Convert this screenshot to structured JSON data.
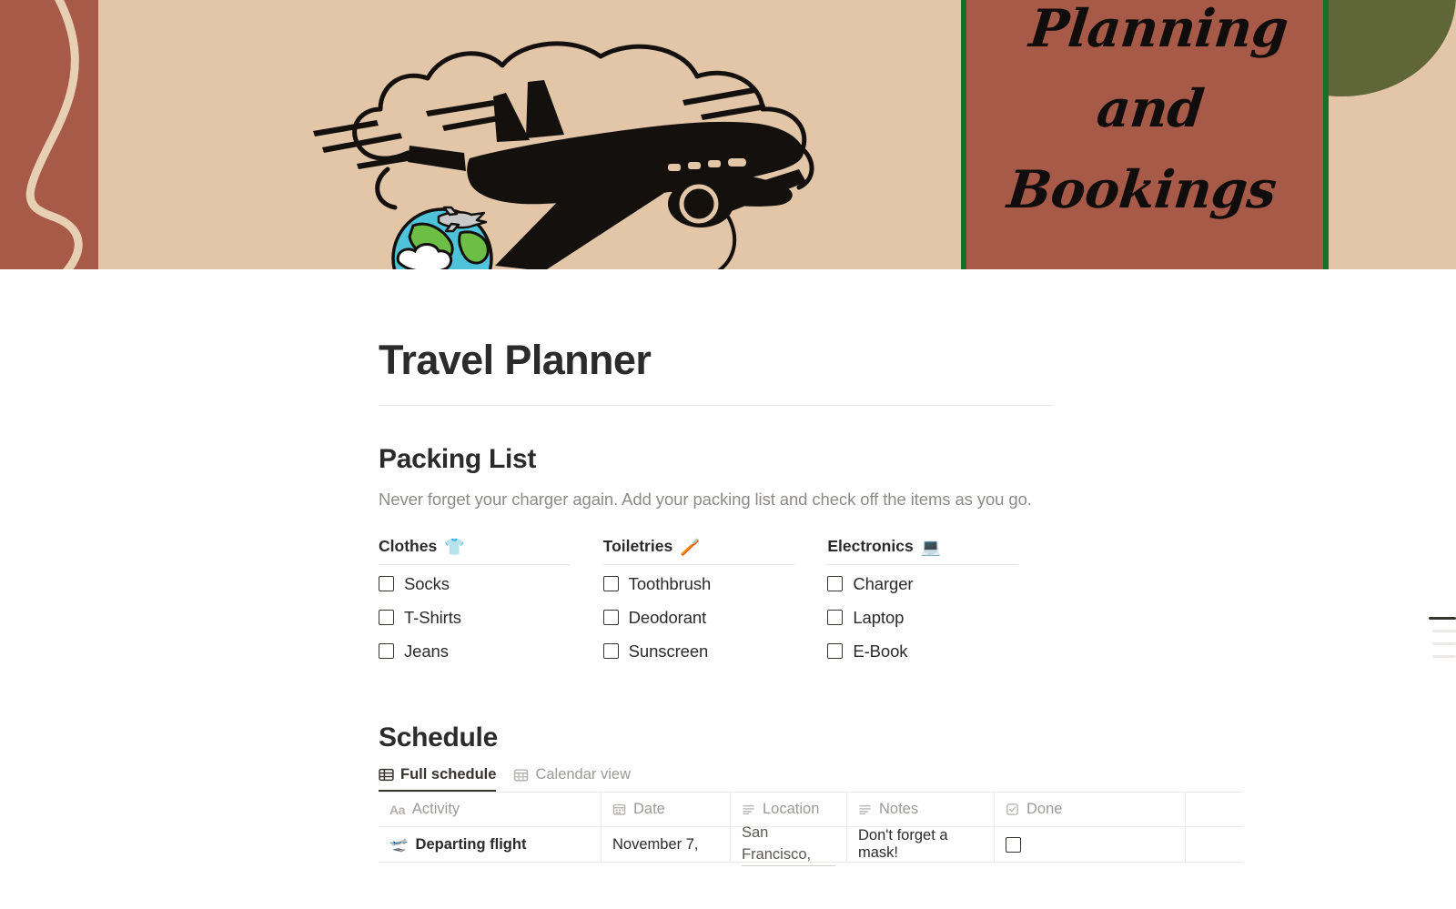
{
  "cover": {
    "script_line1": "Planning and",
    "script_line2": "Bookings",
    "colors": {
      "rust": "#a85a48",
      "beige": "#e3c6a8",
      "olive": "#5f6638",
      "green_border": "#177028",
      "ink": "#100d0c"
    },
    "artwork_name": "vintage-airplane-illustration",
    "globe_emoji": "🌍"
  },
  "page": {
    "title": "Travel Planner"
  },
  "packing": {
    "heading": "Packing List",
    "description": "Never forget your charger again. Add your packing list and check off the items as you go.",
    "columns": [
      {
        "title": "Clothes",
        "emoji": "👕",
        "emoji_name": "t-shirt-emoji",
        "items": [
          "Socks",
          "T-Shirts",
          "Jeans"
        ]
      },
      {
        "title": "Toiletries",
        "emoji": "🪥",
        "emoji_name": "toothbrush-emoji",
        "items": [
          "Toothbrush",
          "Deodorant",
          "Sunscreen"
        ]
      },
      {
        "title": "Electronics",
        "emoji": "💻",
        "emoji_name": "laptop-emoji",
        "items": [
          "Charger",
          "Laptop",
          "E-Book"
        ]
      }
    ]
  },
  "schedule": {
    "heading": "Schedule",
    "views": [
      {
        "label": "Full schedule",
        "icon": "table-icon",
        "active": true
      },
      {
        "label": "Calendar view",
        "icon": "calendar-icon",
        "active": false
      }
    ],
    "table": {
      "columns": [
        {
          "label": "Activity",
          "icon": "text-type-icon"
        },
        {
          "label": "Date",
          "icon": "calendar-type-icon"
        },
        {
          "label": "Location",
          "icon": "text-lines-icon"
        },
        {
          "label": "Notes",
          "icon": "text-lines-icon"
        },
        {
          "label": "Done",
          "icon": "checkbox-type-icon"
        }
      ],
      "rows": [
        {
          "activity": "Departing flight",
          "activity_emoji": "🛫",
          "date": "November 7,",
          "location": "San Francisco,",
          "notes": "Don't forget a mask!",
          "done": false
        }
      ]
    }
  },
  "toc": {
    "items": [
      {
        "state": "active"
      },
      {
        "state": "dim"
      },
      {
        "state": "dim"
      },
      {
        "state": "dim"
      }
    ]
  }
}
